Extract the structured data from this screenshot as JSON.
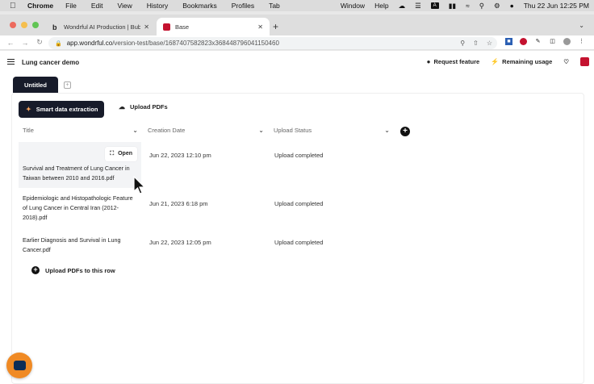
{
  "menubar": {
    "app": "Chrome",
    "items": [
      "File",
      "Edit",
      "View",
      "History",
      "Bookmarks",
      "Profiles",
      "Tab"
    ],
    "window": "Window",
    "help": "Help",
    "input_badge": "A",
    "datetime": "Thu 22 Jun  12:25 PM"
  },
  "browser": {
    "tabs": [
      {
        "label": "Wondrful AI Production | Bubb",
        "favicon": "b"
      },
      {
        "label": "Base"
      }
    ],
    "url_host": "app.wondrful.co",
    "url_path": "/version-test/base/1687407582823x368448796041150460"
  },
  "app": {
    "project_name": "Lung cancer demo",
    "request_feature": "Request feature",
    "remaining_usage": "Remaining usage",
    "view_tab": "Untitled",
    "smart_extraction": "Smart data extraction",
    "upload_pdfs": "Upload PDFs",
    "columns": [
      "Title",
      "Creation Date",
      "Upload Status"
    ],
    "open_label": "Open",
    "rows": [
      {
        "title": "Survival and Treatment of Lung Cancer in Taiwan between 2010 and 2016.pdf",
        "date": "Jun 22, 2023 12:10 pm",
        "status": "Upload completed"
      },
      {
        "title": "Epidemiologic and Histopathologic Feature of Lung Cancer in Central Iran (2012-2018).pdf",
        "date": "Jun 21, 2023 6:18 pm",
        "status": "Upload completed"
      },
      {
        "title": "Earlier Diagnosis and Survival in Lung Cancer.pdf",
        "date": "Jun 22, 2023 12:05 pm",
        "status": "Upload completed"
      }
    ],
    "upload_row": "Upload PDFs to this row"
  },
  "colors": {
    "primary_dark": "#171b2a",
    "brand_red": "#c4122f",
    "chat_orange": "#f08a24"
  }
}
